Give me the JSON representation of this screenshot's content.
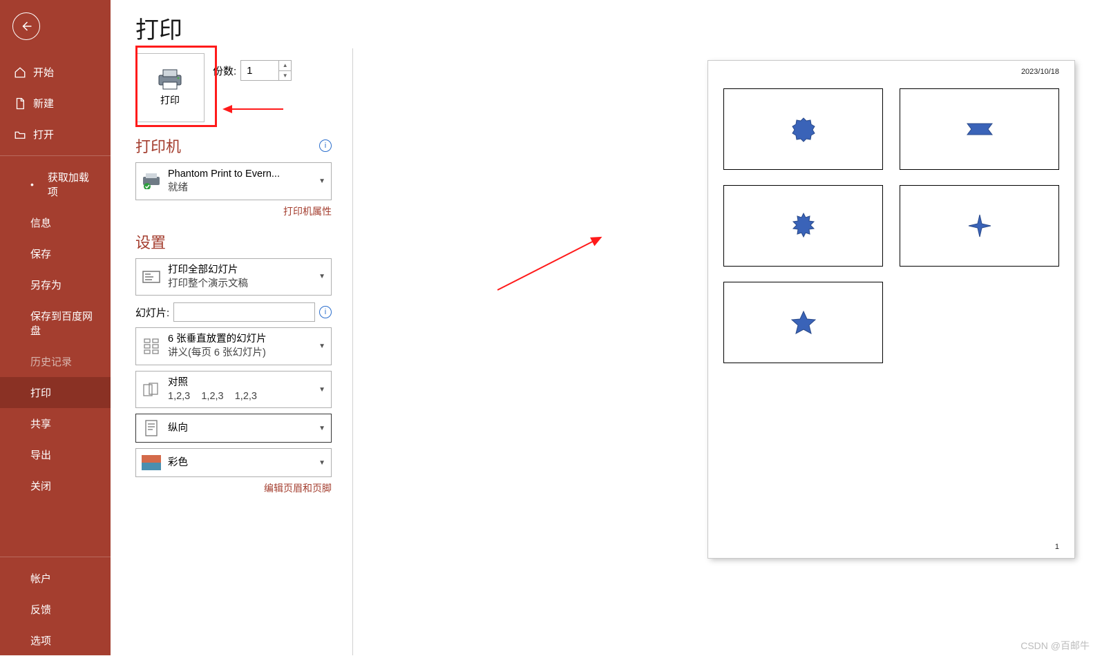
{
  "sidebar": {
    "nav": [
      "开始",
      "新建",
      "打开"
    ],
    "items": [
      "获取加载项",
      "信息",
      "保存",
      "另存为",
      "保存到百度网盘",
      "历史记录",
      "打印",
      "共享",
      "导出",
      "关闭"
    ],
    "footer": [
      "帐户",
      "反馈",
      "选项"
    ]
  },
  "page": {
    "title": "打印",
    "copies_label": "份数:",
    "copies_value": "1",
    "print_label": "打印"
  },
  "printer": {
    "heading": "打印机",
    "name": "Phantom Print to Evern...",
    "status": "就绪",
    "props_link": "打印机属性"
  },
  "settings": {
    "heading": "设置",
    "slides_label": "幻灯片:",
    "opt_range": {
      "l1": "打印全部幻灯片",
      "l2": "打印整个演示文稿"
    },
    "opt_layout": {
      "l1": "6 张垂直放置的幻灯片",
      "l2": "讲义(每页 6 张幻灯片)"
    },
    "opt_collate": {
      "l1": "对照",
      "l2": "1,2,3    1,2,3    1,2,3"
    },
    "opt_orient": "纵向",
    "opt_color": "彩色",
    "edit_hf": "编辑页眉和页脚"
  },
  "preview": {
    "date": "2023/10/18",
    "pagenum": "1"
  },
  "watermark": "CSDN @百邮牛"
}
